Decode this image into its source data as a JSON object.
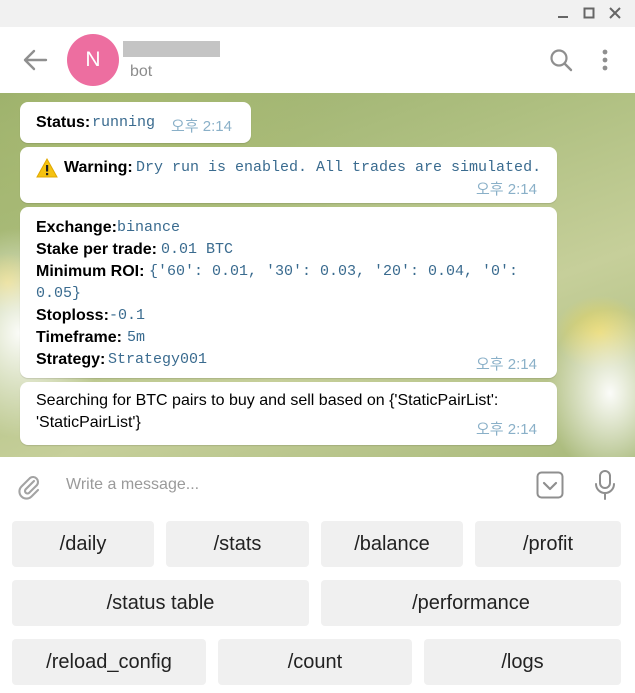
{
  "header": {
    "avatar_letter": "N",
    "subtitle": "bot"
  },
  "icons": [
    "minimize-icon",
    "maximize-icon",
    "close-icon",
    "back-arrow-icon",
    "search-icon",
    "more-vertical-icon",
    "warning-icon",
    "attach-icon",
    "bot-keyboard-icon",
    "microphone-icon"
  ],
  "messages": {
    "status": {
      "label": "Status:",
      "value": "running",
      "time": "오후 2:14"
    },
    "warning": {
      "label": "Warning:",
      "value": "Dry run is enabled. All trades are simulated.",
      "time": "오후 2:14"
    },
    "config": {
      "exchange_label": "Exchange:",
      "exchange": "binance",
      "stake_label": "Stake per trade:",
      "stake": "0.01 BTC",
      "roi_label": "Minimum ROI:",
      "roi_line1": "{'60': 0.01, '30': 0.03, '20': 0.04, '0':",
      "roi_line2": "0.05}",
      "stoploss_label": "Stoploss:",
      "stoploss": "-0.1",
      "timeframe_label": "Timeframe:",
      "timeframe": "5m",
      "strategy_label": "Strategy:",
      "strategy": "Strategy001",
      "time": "오후 2:14"
    },
    "search": {
      "line1": "Searching for BTC pairs to buy and sell based on {'StaticPairList':",
      "line2": "'StaticPairList'}",
      "time": "오후 2:14"
    }
  },
  "composer": {
    "placeholder": "Write a message..."
  },
  "keyboard": {
    "row1": [
      "/daily",
      "/stats",
      "/balance",
      "/profit"
    ],
    "row2": [
      "/status table",
      "/performance"
    ],
    "row3": [
      "/reload_config",
      "/count",
      "/logs"
    ]
  },
  "colors": {
    "avatar": "#ed6ea0",
    "mono_text": "#3a6b8f",
    "time_text": "#8ab0c8"
  }
}
